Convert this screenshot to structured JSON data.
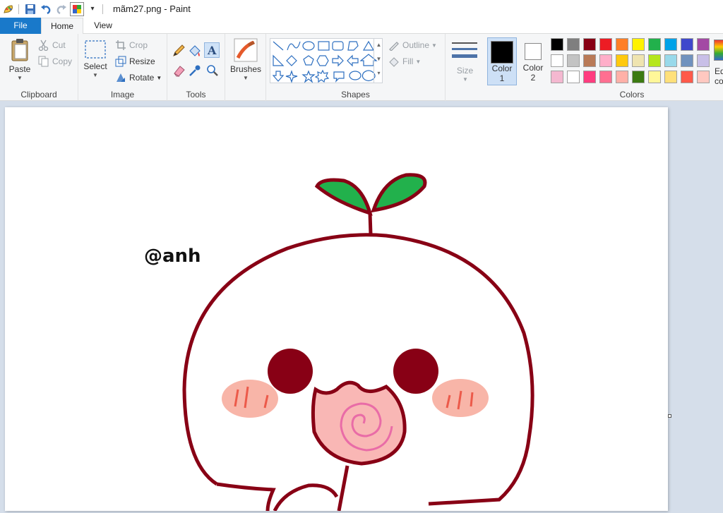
{
  "window": {
    "title": "mãm27.png - Paint"
  },
  "tabs": {
    "file": "File",
    "home": "Home",
    "view": "View"
  },
  "clipboard": {
    "paste": "Paste",
    "cut": "Cut",
    "copy": "Copy",
    "label": "Clipboard"
  },
  "image": {
    "select": "Select",
    "crop": "Crop",
    "resize": "Resize",
    "rotate": "Rotate",
    "label": "Image"
  },
  "tools": {
    "label": "Tools"
  },
  "brushes": {
    "label": "Brushes"
  },
  "shapes": {
    "outline": "Outline",
    "fill": "Fill",
    "label": "Shapes"
  },
  "size": {
    "label": "Size"
  },
  "color1": {
    "label": "Color",
    "num": "1",
    "value": "#000000"
  },
  "color2": {
    "label": "Color",
    "num": "2",
    "value": "#ffffff"
  },
  "colors": {
    "label": "Colors",
    "edit_line1": "Ed",
    "edit_line2": "col"
  },
  "palette": [
    [
      "#000000",
      "#7f7f7f",
      "#880015",
      "#ed1c24",
      "#ff7f27",
      "#fff200",
      "#22b14c",
      "#00a2e8",
      "#3f48cc",
      "#a349a4"
    ],
    [
      "#ffffff",
      "#c3c3c3",
      "#b97a57",
      "#ffaec9",
      "#ffc90e",
      "#efe4b0",
      "#b5e61d",
      "#99d9ea",
      "#7092be",
      "#c8bfe7"
    ],
    [
      "#f4b8d0",
      "#ffffff",
      "#ff3d7f",
      "#ff6f91",
      "#ffb0a8",
      "#3c7a12",
      "#fff799",
      "#ffe07a",
      "#ff5a4a",
      "#ffc8c0"
    ]
  ],
  "drawing": {
    "watermark": "@anh",
    "outline_color": "#880015",
    "leaf_color": "#22b14c",
    "blush_color": "#f8b5a8",
    "nose_color": "#f9b7b5"
  }
}
